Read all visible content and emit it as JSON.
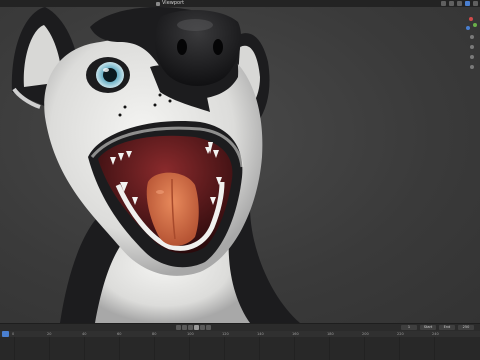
{
  "app": {
    "name": "Blender"
  },
  "header": {
    "viewport_label": "Viewport"
  },
  "timeline": {
    "start_field": "1",
    "start_value": "Start",
    "end_field": "End",
    "end_value": "250",
    "ruler_ticks": [
      "0",
      "20",
      "40",
      "60",
      "80",
      "100",
      "120",
      "140",
      "160",
      "180",
      "200",
      "220",
      "240"
    ]
  },
  "colors": {
    "accent": "#4a7fd0",
    "fur_white": "#e8e8e6",
    "fur_black": "#1c1c1e",
    "tongue": "#d9734a",
    "mouth": "#5a1a1c",
    "eye": "#7ab6c8"
  },
  "icons": {
    "gizmo_x": "axis-x-icon",
    "gizmo_y": "axis-y-icon",
    "gizmo_z": "axis-z-icon"
  }
}
